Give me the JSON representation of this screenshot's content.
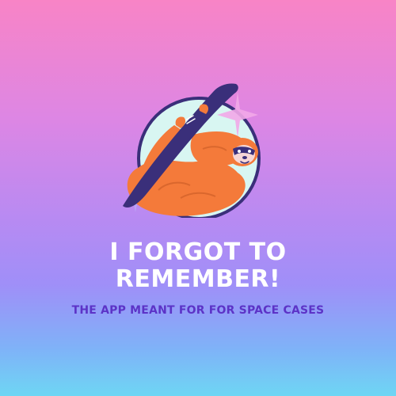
{
  "colors": {
    "gradient_top": "#f884c6",
    "gradient_bottom": "#6ed6f4",
    "headline_text": "#ffffff",
    "tagline_text": "#5c33c7",
    "sloth_fur": "#f47a3a",
    "branch": "#3a2f7a",
    "circle_fill": "#d8f6f2",
    "sparkle": "#f2a9e8"
  },
  "logo": {
    "icon": "sloth-hanging-on-branch-icon",
    "sparkle_icons": [
      "sparkle-large-icon",
      "sparkle-small-icon"
    ]
  },
  "headline": {
    "line1": "I FORGOT TO",
    "line2": "REMEMBER!"
  },
  "tagline": "THE APP MEANT FOR FOR SPACE CASES"
}
